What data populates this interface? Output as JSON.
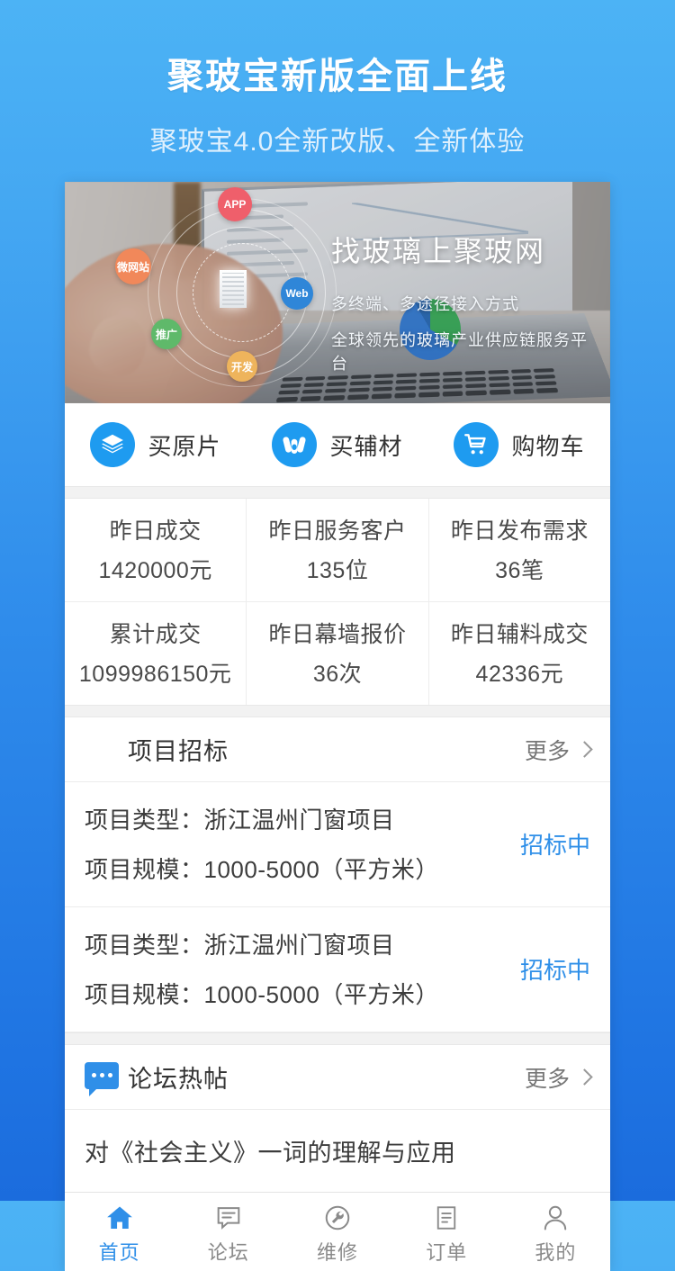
{
  "promo": {
    "title": "聚玻宝新版全面上线",
    "subtitle": "聚玻宝4.0全新改版、全新体验"
  },
  "banner": {
    "heading": "找玻璃上聚玻网",
    "line1": "多终端、多途径接入方式",
    "line2": "全球领先的玻璃产业供应链服务平台",
    "bubbles": [
      {
        "label": "APP",
        "color": "#ef5f6b"
      },
      {
        "label": "微网站",
        "color": "#f1885a"
      },
      {
        "label": "Web",
        "color": "#2f86d8"
      },
      {
        "label": "推广",
        "color": "#5fb96a"
      },
      {
        "label": "开发",
        "color": "#eeb45c"
      }
    ]
  },
  "quick_actions": [
    {
      "label": "买原片",
      "icon": "layers-icon"
    },
    {
      "label": "买辅材",
      "icon": "material-rolls-icon"
    },
    {
      "label": "购物车",
      "icon": "shopping-cart-icon"
    }
  ],
  "stats": [
    [
      {
        "label": "昨日成交",
        "value": "1420000元"
      },
      {
        "label": "昨日服务客户",
        "value": "135位"
      },
      {
        "label": "昨日发布需求",
        "value": "36笔"
      }
    ],
    [
      {
        "label": "累计成交",
        "value": "1099986150元"
      },
      {
        "label": "昨日幕墙报价",
        "value": "36次"
      },
      {
        "label": "昨日辅料成交",
        "value": "42336元"
      }
    ]
  ],
  "bidding": {
    "section_title": "项目招标",
    "more_label": "更多",
    "items": [
      {
        "type_label": "项目类型：",
        "type_value": "浙江温州门窗项目",
        "scale_label": "项目规模：",
        "scale_value": "1000-5000（平方米）",
        "status": "招标中"
      },
      {
        "type_label": "项目类型：",
        "type_value": "浙江温州门窗项目",
        "scale_label": "项目规模：",
        "scale_value": "1000-5000（平方米）",
        "status": "招标中"
      }
    ]
  },
  "forum": {
    "section_title": "论坛热帖",
    "more_label": "更多",
    "posts": [
      {
        "title": "对《社会主义》一词的理解与应用"
      }
    ]
  },
  "tabbar": [
    {
      "label": "首页",
      "icon": "home-icon",
      "active": true
    },
    {
      "label": "论坛",
      "icon": "forum-icon",
      "active": false
    },
    {
      "label": "维修",
      "icon": "wrench-icon",
      "active": false
    },
    {
      "label": "订单",
      "icon": "order-icon",
      "active": false
    },
    {
      "label": "我的",
      "icon": "user-icon",
      "active": false
    }
  ],
  "colors": {
    "background_top": "#4cb3f5",
    "background_bottom": "#1b6cdd",
    "accent_blue": "#1e9bf0",
    "status_blue": "#2f8fe8",
    "bookmark_red": "#f4433a"
  }
}
